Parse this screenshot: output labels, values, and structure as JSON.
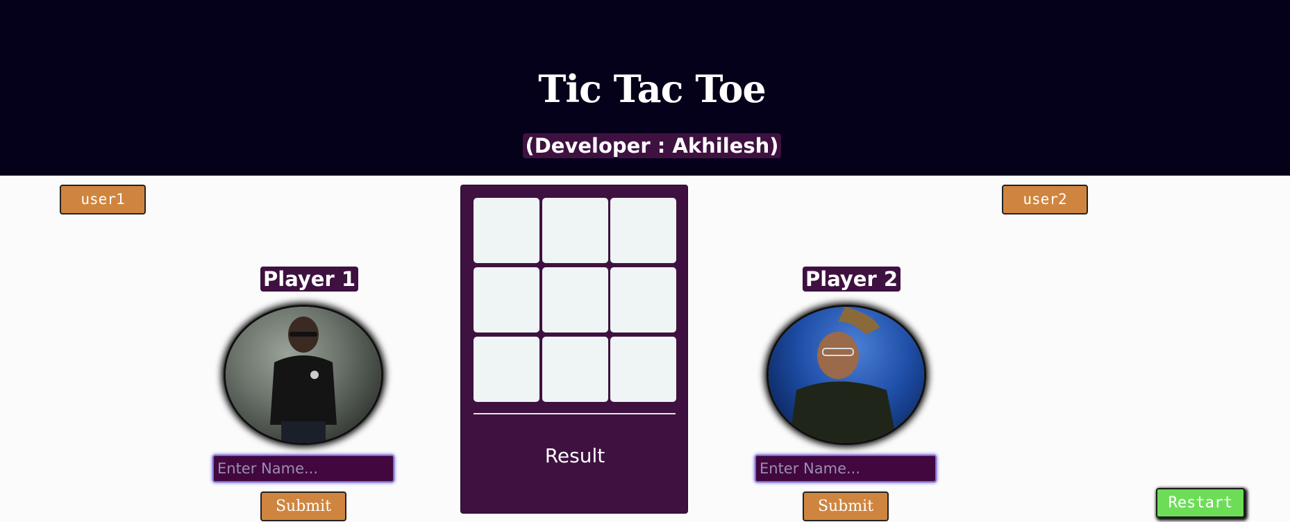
{
  "header": {
    "title": "Tic Tac Toe",
    "developer": "(Developer : Akhilesh)"
  },
  "users": {
    "user1_label": "user1",
    "user2_label": "user2"
  },
  "players": [
    {
      "label": "Player 1",
      "placeholder": "Enter Name...",
      "submit_label": "Submit"
    },
    {
      "label": "Player 2",
      "placeholder": "Enter Name...",
      "submit_label": "Submit"
    }
  ],
  "board": {
    "cells": [
      "",
      "",
      "",
      "",
      "",
      "",
      "",
      "",
      ""
    ],
    "result_text": "Result"
  },
  "restart_label": "Restart",
  "colors": {
    "header_bg": "#05011a",
    "accent_purple": "#3e1140",
    "button_orange": "#cf853f",
    "restart_green": "#6ddd58",
    "cell_bg": "#eff4f5"
  }
}
